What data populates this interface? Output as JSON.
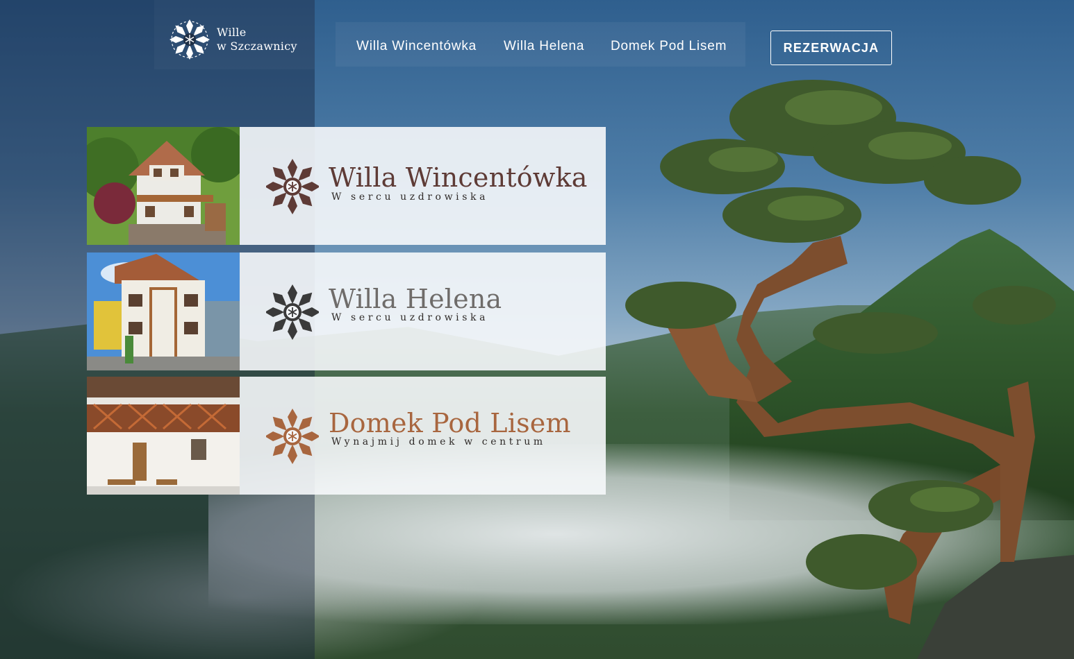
{
  "brand": {
    "line1": "Wille",
    "line2": "w Szczawnicy",
    "logo_icon": "snowflake-ornament-icon"
  },
  "nav": {
    "items": [
      {
        "label": "Willa Wincentówka"
      },
      {
        "label": "Willa Helena"
      },
      {
        "label": "Domek Pod Lisem"
      }
    ],
    "reservation_label": "REZERWACJA"
  },
  "villas": [
    {
      "name": "Willa Wincentówka",
      "tagline": "W sercu uzdrowiska",
      "color": "#5e3b36"
    },
    {
      "name": "Willa Helena",
      "tagline": "W sercu uzdrowiska",
      "color": "#6f6c6a"
    },
    {
      "name": "Domek Pod Lisem",
      "tagline": "Wynajmij domek w centrum",
      "color": "#a8663f"
    }
  ],
  "colors": {
    "overlay_panel": "#12203a",
    "card_background": "#f6f8fb",
    "ornament_brown": "#5e3b36",
    "ornament_gray": "#3a3a3a",
    "ornament_copper": "#a8663f"
  }
}
